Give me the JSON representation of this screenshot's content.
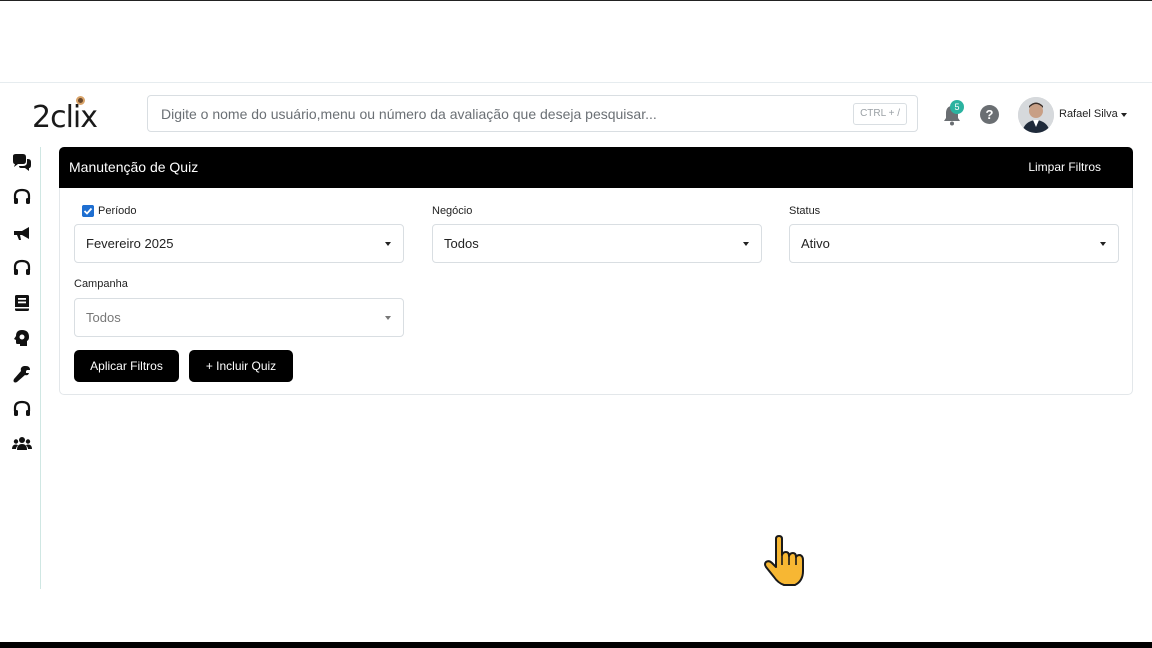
{
  "header": {
    "logo_text": "2clix",
    "search": {
      "placeholder": "Digite o nome do usuário,menu ou número da avaliação que deseja pesquisar...",
      "shortcut": "CTRL + /"
    },
    "notifications_count": "5",
    "help_label": "?",
    "user_name": "Rafael Silva"
  },
  "sidebar": {
    "icons": [
      "chat-bubbles-icon",
      "headset-icon",
      "megaphone-icon",
      "headset-icon",
      "book-icon",
      "brain-icon",
      "wrench-icon",
      "headset-icon",
      "users-icon"
    ]
  },
  "card": {
    "title": "Manutenção de Quiz",
    "clear_filters": "Limpar Filtros",
    "filters": {
      "periodo": {
        "label": "Período",
        "checked": true,
        "value": "Fevereiro 2025"
      },
      "negocio": {
        "label": "Negócio",
        "value": "Todos"
      },
      "status": {
        "label": "Status",
        "value": "Ativo"
      },
      "campanha": {
        "label": "Campanha",
        "value": "Todos"
      }
    },
    "buttons": {
      "apply": "Aplicar Filtros",
      "add_quiz": "+ Incluir Quiz"
    }
  },
  "colors": {
    "header_bar": "#000000",
    "accent_checkbox": "#1f6fd1",
    "badge": "#2bb3a0"
  }
}
